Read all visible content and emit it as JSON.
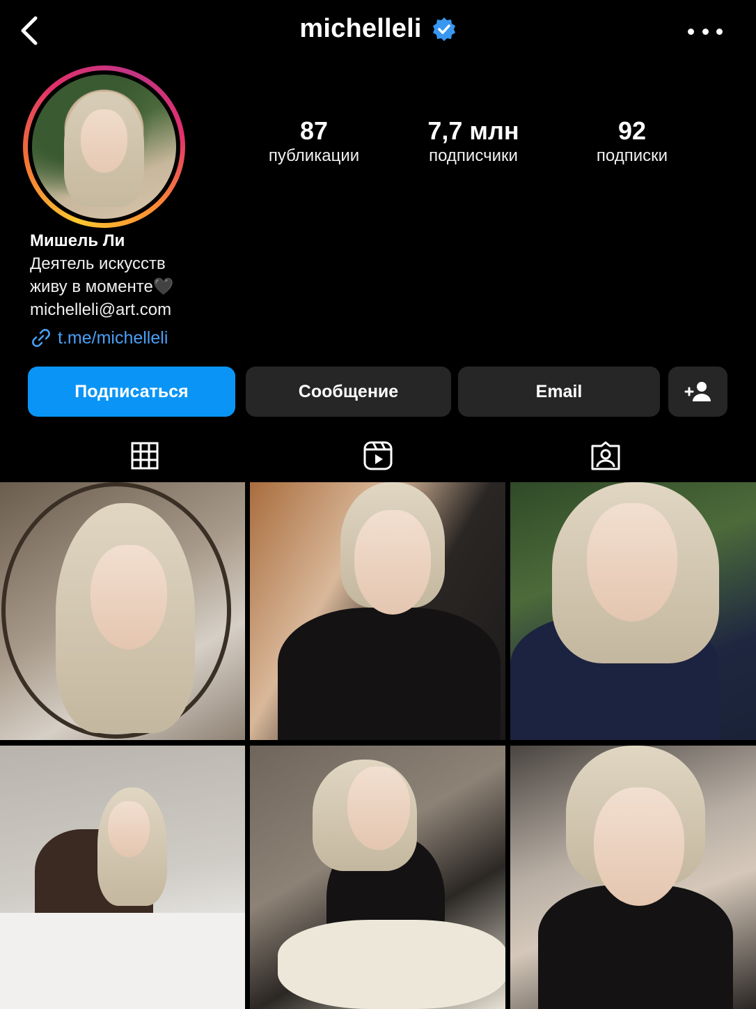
{
  "header": {
    "username": "michelleli",
    "verified": true
  },
  "stats": {
    "posts": {
      "value": "87",
      "label": "публикации"
    },
    "followers": {
      "value": "7,7 млн",
      "label": "подписчики"
    },
    "following": {
      "value": "92",
      "label": "подписки"
    }
  },
  "bio": {
    "name": "Мишель Ли",
    "category": "Деятель искусств",
    "line": "живу в моменте🖤",
    "email": "michelleli@art.com",
    "link": "t.me/michelleli"
  },
  "actions": {
    "follow": "Подписаться",
    "message": "Сообщение",
    "email": "Email"
  },
  "colors": {
    "background": "#000000",
    "accent": "#0a95f6",
    "secondary_button": "#262626",
    "link": "#4a9ff5",
    "verified_badge": "#3897f0"
  },
  "icons": {
    "back": "chevron-left-icon",
    "verified": "verified-badge-icon",
    "more": "more-horizontal-icon",
    "add_user": "add-user-icon",
    "link": "link-icon",
    "grid_tab": "grid-icon",
    "reels_tab": "reels-icon",
    "tagged_tab": "tagged-icon"
  },
  "active_tab": "grid",
  "posts": [
    {
      "description": "mirror-selfie"
    },
    {
      "description": "black-blazer-necklace"
    },
    {
      "description": "navy-top-plants"
    },
    {
      "description": "leaning-table-bag"
    },
    {
      "description": "black-dress-roses"
    },
    {
      "description": "hand-on-cheek"
    }
  ]
}
